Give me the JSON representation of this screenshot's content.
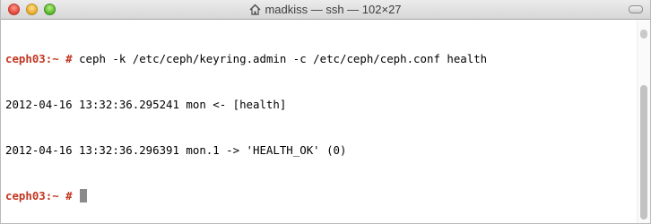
{
  "window": {
    "title": "madkiss — ssh — 102×27"
  },
  "terminal": {
    "lines": [
      {
        "prompt": "ceph03:~ #",
        "text": " ceph -k /etc/ceph/keyring.admin -c /etc/ceph/ceph.conf health"
      },
      {
        "prompt": "",
        "text": "2012-04-16 13:32:36.295241 mon <- [health]"
      },
      {
        "prompt": "",
        "text": "2012-04-16 13:32:36.296391 mon.1 -> 'HEALTH_OK' (0)"
      },
      {
        "prompt": "ceph03:~ #",
        "text": " "
      }
    ]
  },
  "colors": {
    "prompt": "#c23621",
    "cursor": "#8a8a8a"
  },
  "icons": {
    "title_icon": "home-icon"
  }
}
